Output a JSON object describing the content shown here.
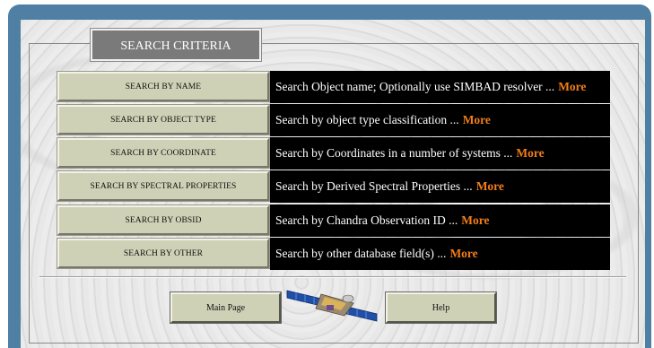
{
  "legend": {
    "title": "SEARCH CRITERIA"
  },
  "criteria": [
    {
      "button": "SEARCH BY NAME",
      "description": "Search Object name; Optionally use SIMBAD resolver ...",
      "more": "More"
    },
    {
      "button": "SEARCH BY OBJECT TYPE",
      "description": "Search by object type classification ...",
      "more": "More"
    },
    {
      "button": "SEARCH BY COORDINATE",
      "description": "Search by Coordinates in a number of systems ...",
      "more": "More"
    },
    {
      "button": "SEARCH BY SPECTRAL PROPERTIES",
      "description": "Search by Derived Spectral Properties ...",
      "more": "More"
    },
    {
      "button": "SEARCH BY OBSID",
      "description": "Search by Chandra Observation ID ...",
      "more": "More"
    },
    {
      "button": "SEARCH BY OTHER",
      "description": "Search by other database field(s) ...",
      "more": "More"
    }
  ],
  "footer": {
    "main_page": "Main Page",
    "help": "Help",
    "image": "satellite-image"
  },
  "colors": {
    "frame": "#4f7fa3",
    "button": "#cfd1b6",
    "description_bg": "#000000",
    "more_link": "#f07d19"
  }
}
